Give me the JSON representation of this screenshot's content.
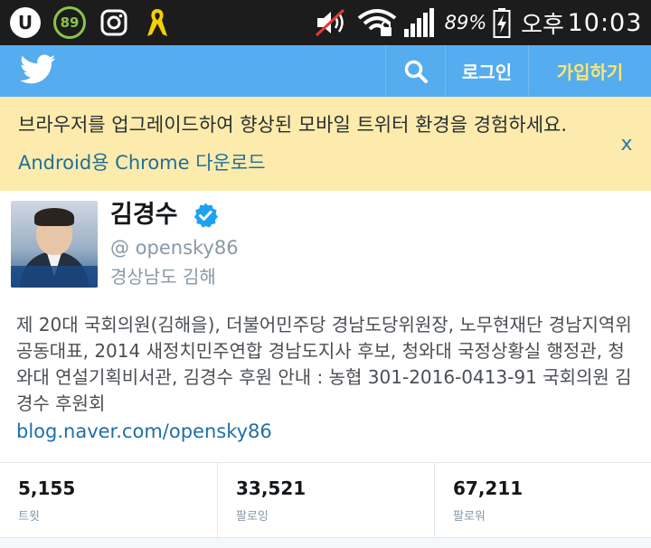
{
  "status_bar": {
    "app_badge_letter": "U",
    "notification_count": "89",
    "battery_percent": "89%",
    "ampm": "오후",
    "time": "10:03",
    "icons": [
      "u-plus-icon",
      "badge-89-icon",
      "instagram-icon",
      "yellow-ribbon-icon",
      "mute-icon",
      "wifi-icon",
      "signal-icon",
      "battery-charging-icon"
    ]
  },
  "header": {
    "logo": "twitter-bird-icon",
    "search_icon": "search-icon",
    "login_label": "로그인",
    "signup_label": "가입하기",
    "colors": {
      "bar": "#55acee",
      "signup": "#ffe66d"
    }
  },
  "banner": {
    "message": "브라우저를 업그레이드하여 향상된 모바일 트위터 환경을 경험하세요.",
    "link_text": "Android용 Chrome 다운로드",
    "close_label": "x",
    "background": "#fcebac"
  },
  "profile": {
    "name": "김경수",
    "verified": true,
    "handle": "@ opensky86",
    "location": "경상남도 김해",
    "bio": "제 20대 국회의원(김해을), 더불어민주당 경남도당위원장, 노무현재단 경남지역위 공동대표, 2014 새정치민주연합 경남도지사 후보, 청와대 국정상황실 행정관, 청와대 연설기획비서관, 김경수 후원 안내 : 농협 301-2016-0413-91 국회의원 김경수 후원회",
    "link": "blog.naver.com/opensky86"
  },
  "stats": [
    {
      "value": "5,155",
      "label": "트윗"
    },
    {
      "value": "33,521",
      "label": "팔로잉"
    },
    {
      "value": "67,211",
      "label": "팔로워"
    }
  ]
}
